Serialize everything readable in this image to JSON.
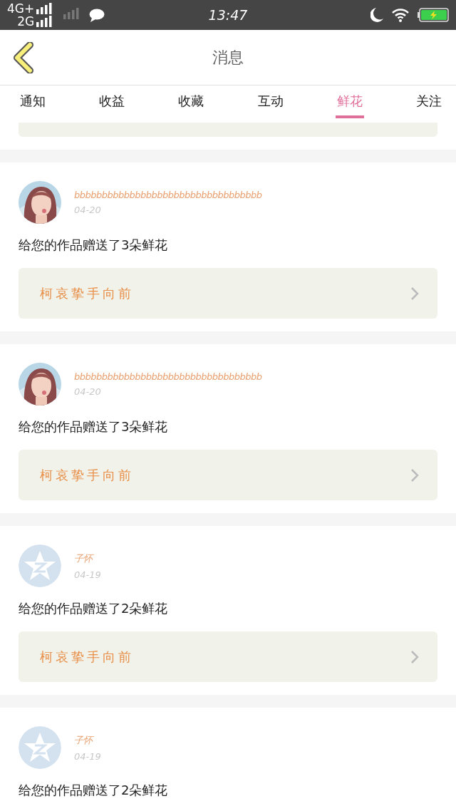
{
  "status_bar": {
    "network_1": "4G+",
    "network_2": "2G",
    "time": "13:47"
  },
  "header": {
    "title": "消息"
  },
  "tabs": [
    {
      "label": "通知",
      "selected": false
    },
    {
      "label": "收益",
      "selected": false
    },
    {
      "label": "收藏",
      "selected": false
    },
    {
      "label": "互动",
      "selected": false
    },
    {
      "label": "鲜花",
      "selected": true
    },
    {
      "label": "关注",
      "selected": false
    }
  ],
  "messages": [
    {
      "name": "bbbbbbbbbbbbbbbbbbbbbbbbbbbbbbbbbb",
      "date": "04-20",
      "text": "给您的作品赠送了3朵鲜花",
      "work": "柯哀挚手向前"
    },
    {
      "name": "bbbbbbbbbbbbbbbbbbbbbbbbbbbbbbbbbb",
      "date": "04-20",
      "text": "给您的作品赠送了3朵鲜花",
      "work": "柯哀挚手向前"
    },
    {
      "avatar": {
        "kind": "icon"
      },
      "name": "子怀",
      "date": "04-19",
      "text": "给您的作品赠送了2朵鲜花",
      "work": "柯哀挚手向前"
    },
    {
      "avatar": {
        "kind": "icon"
      },
      "name": "子怀",
      "date": "04-19",
      "text": "给您的作品赠送了2朵鲜花"
    }
  ]
}
